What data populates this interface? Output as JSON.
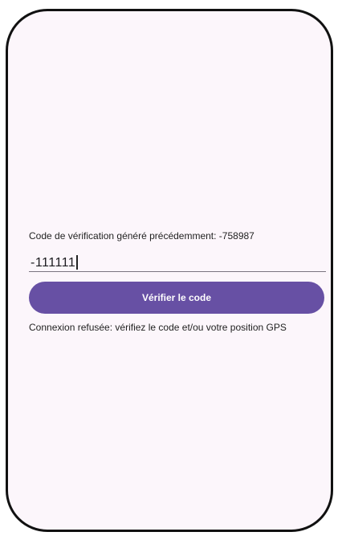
{
  "verification": {
    "previous_code_text": "Code de vérification généré précédemment: -758987",
    "input_value": "-111111",
    "verify_button_label": "Vérifier le code",
    "error_message": "Connexion refusée: vérifiez le code et/ou votre position GPS"
  },
  "colors": {
    "primary": "#6750a4",
    "background": "#fcf6fb",
    "frame": "#111111"
  }
}
